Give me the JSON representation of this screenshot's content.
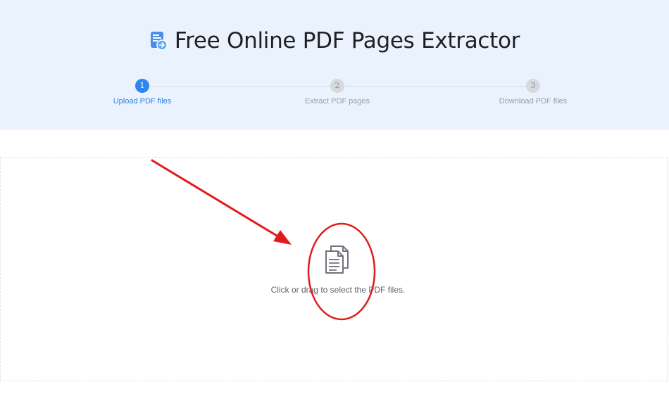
{
  "header": {
    "title": "Free Online PDF Pages Extractor",
    "icon": "pdf-extract-icon"
  },
  "stepper": {
    "steps": [
      {
        "number": "1",
        "label": "Upload PDF files",
        "state": "active"
      },
      {
        "number": "2",
        "label": "Extract PDF pages",
        "state": "inactive"
      },
      {
        "number": "3",
        "label": "Download PDF files",
        "state": "inactive"
      }
    ]
  },
  "dropzone": {
    "icon": "document-stack-icon",
    "hint": "Click or drag to select the PDF files."
  },
  "colors": {
    "header_background": "#eaf3fd",
    "accent": "#2f86f0",
    "annotation": "#e11b1b"
  }
}
